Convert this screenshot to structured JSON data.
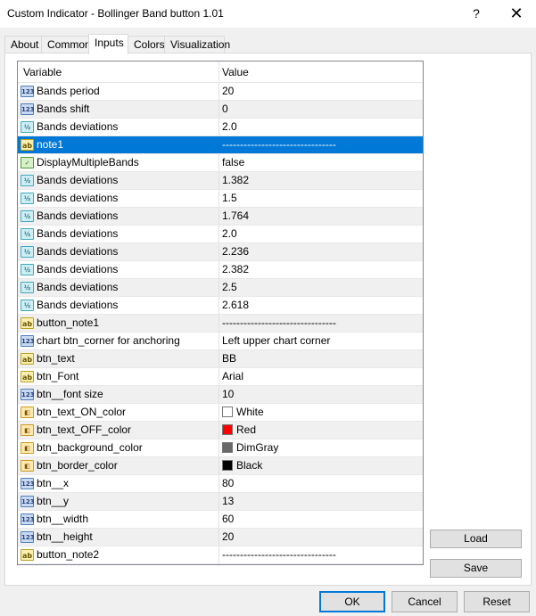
{
  "window": {
    "title": "Custom Indicator - Bollinger Band button 1.01",
    "help_label": "?",
    "close_label": "✕"
  },
  "tabs": [
    {
      "label": "About"
    },
    {
      "label": "Common"
    },
    {
      "label": "Inputs"
    },
    {
      "label": "Colors"
    },
    {
      "label": "Visualization"
    }
  ],
  "active_tab": "Inputs",
  "grid": {
    "header": {
      "variable": "Variable",
      "value": "Value"
    },
    "rows": [
      {
        "icon": "int",
        "icon_text": "123",
        "variable": "Bands period",
        "value": "20"
      },
      {
        "icon": "int",
        "icon_text": "123",
        "variable": "Bands shift",
        "value": "0"
      },
      {
        "icon": "dbl",
        "icon_text": "½",
        "variable": "Bands deviations",
        "value": "2.0"
      },
      {
        "icon": "str",
        "icon_text": "ab",
        "variable": "note1",
        "value": "--------------------------------"
      },
      {
        "icon": "bool",
        "icon_text": "✓",
        "variable": "DisplayMultipleBands",
        "value": "false"
      },
      {
        "icon": "dbl",
        "icon_text": "½",
        "variable": "Bands deviations",
        "value": "1.382"
      },
      {
        "icon": "dbl",
        "icon_text": "½",
        "variable": "Bands deviations",
        "value": "1.5"
      },
      {
        "icon": "dbl",
        "icon_text": "½",
        "variable": "Bands deviations",
        "value": "1.764"
      },
      {
        "icon": "dbl",
        "icon_text": "½",
        "variable": "Bands deviations",
        "value": "2.0"
      },
      {
        "icon": "dbl",
        "icon_text": "½",
        "variable": "Bands deviations",
        "value": "2.236"
      },
      {
        "icon": "dbl",
        "icon_text": "½",
        "variable": "Bands deviations",
        "value": "2.382"
      },
      {
        "icon": "dbl",
        "icon_text": "½",
        "variable": "Bands deviations",
        "value": "2.5"
      },
      {
        "icon": "dbl",
        "icon_text": "½",
        "variable": "Bands deviations",
        "value": "2.618"
      },
      {
        "icon": "str",
        "icon_text": "ab",
        "variable": "button_note1",
        "value": "--------------------------------"
      },
      {
        "icon": "int",
        "icon_text": "123",
        "variable": "chart btn_corner for anchoring",
        "value": "Left upper chart corner"
      },
      {
        "icon": "str",
        "icon_text": "ab",
        "variable": "btn_text",
        "value": "BB"
      },
      {
        "icon": "str",
        "icon_text": "ab",
        "variable": "btn_Font",
        "value": "Arial"
      },
      {
        "icon": "int",
        "icon_text": "123",
        "variable": "btn__font size",
        "value": "10"
      },
      {
        "icon": "color",
        "icon_text": "◧",
        "variable": "btn_text_ON_color",
        "value": "White",
        "swatch": "#ffffff"
      },
      {
        "icon": "color",
        "icon_text": "◧",
        "variable": "btn_text_OFF_color",
        "value": "Red",
        "swatch": "#ff0000"
      },
      {
        "icon": "color",
        "icon_text": "◧",
        "variable": "btn_background_color",
        "value": "DimGray",
        "swatch": "#696969"
      },
      {
        "icon": "color",
        "icon_text": "◧",
        "variable": "btn_border_color",
        "value": "Black",
        "swatch": "#000000"
      },
      {
        "icon": "int",
        "icon_text": "123",
        "variable": "btn__x",
        "value": "80"
      },
      {
        "icon": "int",
        "icon_text": "123",
        "variable": "btn__y",
        "value": "13"
      },
      {
        "icon": "int",
        "icon_text": "123",
        "variable": "btn__width",
        "value": "60"
      },
      {
        "icon": "int",
        "icon_text": "123",
        "variable": "btn__height",
        "value": "20"
      },
      {
        "icon": "str",
        "icon_text": "ab",
        "variable": "button_note2",
        "value": "--------------------------------"
      }
    ],
    "selected_variable": "note1"
  },
  "side_buttons": {
    "load": "Load",
    "save": "Save"
  },
  "bottom_buttons": {
    "ok": "OK",
    "cancel": "Cancel",
    "reset": "Reset"
  }
}
